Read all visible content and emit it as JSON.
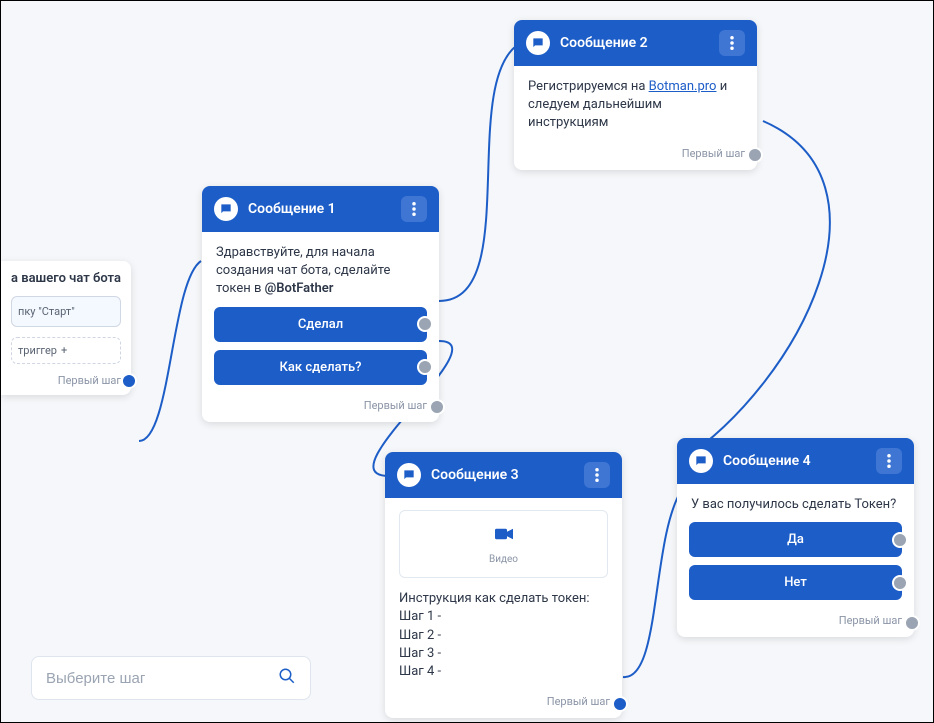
{
  "search": {
    "placeholder": "Выберите шаг"
  },
  "partial_node": {
    "title_fragment": "а вашего чат бота",
    "chip_fragment": "пку \"Старт\"",
    "add_trigger_fragment": "триггер",
    "footer": "Первый шаг"
  },
  "nodes": {
    "msg1": {
      "title": "Сообщение 1",
      "text_pre": "Здравствуйте, для начала создания чат бота, сделайте токен в ",
      "text_bold": "@BotFather",
      "buttons": [
        "Сделал",
        "Как сделать?"
      ],
      "footer": "Первый шаг"
    },
    "msg2": {
      "title": "Сообщение 2",
      "text_pre": "Регистрируемся на ",
      "link_text": "Botman.pro",
      "text_post": " и следуем дальнейшим инструкциям",
      "footer": "Первый шаг"
    },
    "msg3": {
      "title": "Сообщение 3",
      "media_label": "Видео",
      "instr_title": "Инструкция как сделать токен:",
      "steps": [
        "Шаг 1 -",
        "Шаг 2 -",
        "Шаг 3 -",
        "Шаг 4 -"
      ],
      "footer": "Первый шаг"
    },
    "msg4": {
      "title": "Сообщение 4",
      "text": "У вас получилось сделать Токен?",
      "buttons": [
        "Да",
        "Нет"
      ],
      "footer": "Первый шаг"
    }
  }
}
